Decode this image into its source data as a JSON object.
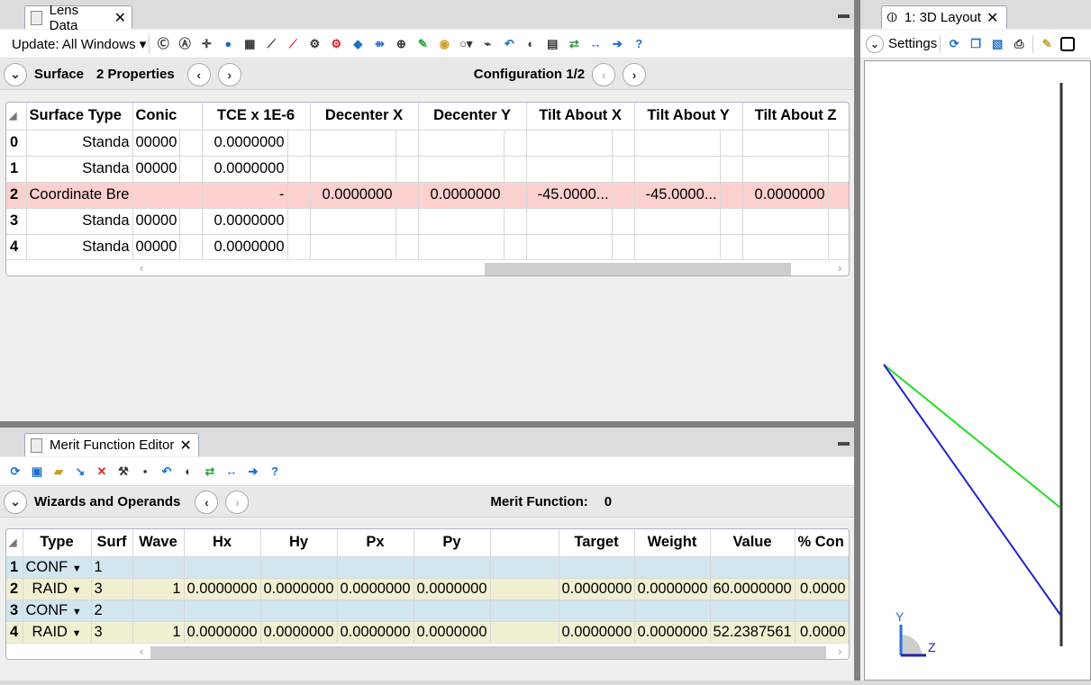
{
  "lens": {
    "tab_title": "Lens Data",
    "update_label": "Update: All Windows",
    "surface_label": "Surface",
    "properties_label": "2 Properties",
    "config_label": "Configuration 1/2",
    "columns": [
      "Surface Type",
      "Conic",
      "TCE x 1E-6",
      "Decenter X",
      "Decenter Y",
      "Tilt About X",
      "Tilt About Y",
      "Tilt About Z"
    ],
    "rows": [
      {
        "num": "0",
        "type": "Standa",
        "conic": "00000",
        "tce": "0.0000000",
        "dx": "",
        "dy": "",
        "tx": "",
        "ty": "",
        "tz": ""
      },
      {
        "num": "1",
        "type": "Standa",
        "conic": "00000",
        "tce": "0.0000000",
        "dx": "",
        "dy": "",
        "tx": "",
        "ty": "",
        "tz": ""
      },
      {
        "num": "2",
        "type": "Coordinate Bre",
        "conic": "",
        "tce": "-",
        "dx": "0.0000000",
        "dy": "0.0000000",
        "tx": "-45.0000...",
        "ty": "-45.0000...",
        "tz": "0.0000000"
      },
      {
        "num": "3",
        "type": "Standa",
        "conic": "00000",
        "tce": "0.0000000",
        "dx": "",
        "dy": "",
        "tx": "",
        "ty": "",
        "tz": ""
      },
      {
        "num": "4",
        "type": "Standa",
        "conic": "00000",
        "tce": "0.0000000",
        "dx": "",
        "dy": "",
        "tx": "",
        "ty": "",
        "tz": ""
      }
    ]
  },
  "merit": {
    "tab_title": "Merit Function Editor",
    "wizards_label": "Wizards and Operands",
    "mf_label": "Merit Function:",
    "mf_value": "0",
    "columns": [
      "Type",
      "Surf",
      "Wave",
      "Hx",
      "Hy",
      "Px",
      "Py",
      "",
      "Target",
      "Weight",
      "Value",
      "% Con"
    ],
    "rows": [
      {
        "num": "1",
        "type": "CONF",
        "surf": "1",
        "wave": "",
        "hx": "",
        "hy": "",
        "px": "",
        "py": "",
        "target": "",
        "weight": "",
        "value": "",
        "con": ""
      },
      {
        "num": "2",
        "type": "RAID",
        "surf": "3",
        "wave": "1",
        "hx": "0.0000000",
        "hy": "0.0000000",
        "px": "0.0000000",
        "py": "0.0000000",
        "target": "0.0000000",
        "weight": "0.0000000",
        "value": "60.0000000",
        "con": "0.0000"
      },
      {
        "num": "3",
        "type": "CONF",
        "surf": "2",
        "wave": "",
        "hx": "",
        "hy": "",
        "px": "",
        "py": "",
        "target": "",
        "weight": "",
        "value": "",
        "con": ""
      },
      {
        "num": "4",
        "type": "RAID",
        "surf": "3",
        "wave": "1",
        "hx": "0.0000000",
        "hy": "0.0000000",
        "px": "0.0000000",
        "py": "0.0000000",
        "target": "0.0000000",
        "weight": "0.0000000",
        "value": "52.2387561",
        "con": "0.0000"
      }
    ]
  },
  "layout": {
    "tab_title": "1: 3D Layout",
    "settings_label": "Settings",
    "axis_y": "Y",
    "axis_z": "Z"
  },
  "colors": {
    "highlight_row": "#fdd0d0",
    "conf_row": "#d2e6f0",
    "raid_row": "#f1efd2",
    "ray_green": "#22dd22",
    "ray_blue": "#2222cc"
  }
}
